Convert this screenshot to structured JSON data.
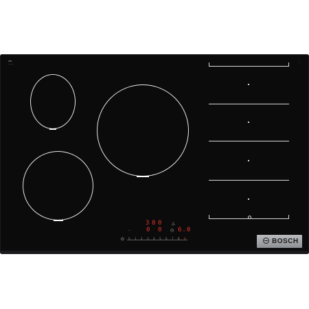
{
  "product": {
    "brand": "BOSCH",
    "model_line_1": "PIE..",
    "model_line_2": "........"
  },
  "display": {
    "level_left": "3",
    "level_right": "0",
    "timer_left": "8",
    "timer_right": "0",
    "level_mid": "0",
    "level_far": "6.0"
  },
  "slider": {
    "numbers": [
      "0",
      "1",
      "2",
      "3",
      "4",
      "5",
      "6",
      "7",
      "8",
      "9"
    ]
  },
  "colors": {
    "glass": "#0b0b0c",
    "zone_outline": "#e8e8e8",
    "display_red": "#e0352b",
    "brand_plate": "#a0a3a7"
  },
  "icons": {
    "power": "power-icon",
    "logo": "bosch-logo-icon"
  }
}
